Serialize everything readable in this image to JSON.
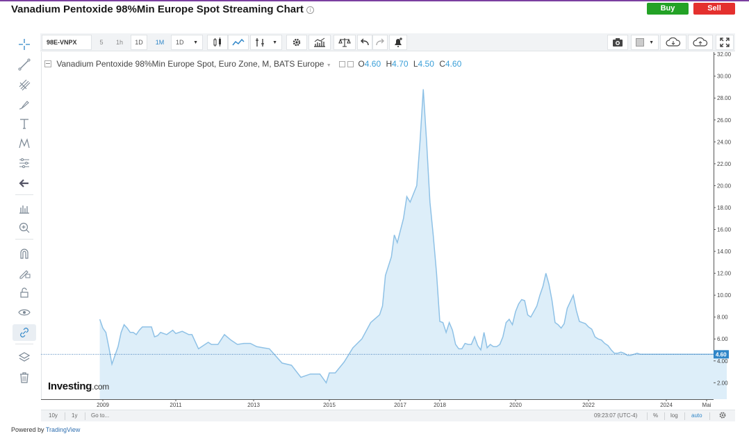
{
  "header": {
    "title": "Vanadium Pentoxide 98%Min Europe Spot Streaming Chart",
    "info_glyph": "i",
    "buy_label": "Buy",
    "sell_label": "Sell"
  },
  "toolbar": {
    "symbol": "98E-VNPX",
    "intervals": [
      "5",
      "1h",
      "1D",
      "1M"
    ],
    "active_interval": "1M",
    "interval_dropdown": "1D",
    "icons": [
      "bars-style-icon",
      "area-style-icon",
      "indicators-icon",
      "settings-icon",
      "studies-icon",
      "compare-icon",
      "undo-icon",
      "redo-icon",
      "alert-icon",
      "camera-icon",
      "layout-icon",
      "cloud-load-icon",
      "cloud-save-icon",
      "fullscreen-icon"
    ]
  },
  "left_tools": [
    "crosshair-icon",
    "trend-line-icon",
    "pitchfork-icon",
    "brush-icon",
    "text-icon",
    "pattern-icon",
    "measure-icon",
    "back-arrow-icon",
    "ruler-icon",
    "zoom-icon",
    "magnet-icon",
    "lock-drawing-icon",
    "unlock-icon",
    "eye-icon",
    "link-icon",
    "layers-icon",
    "trash-icon"
  ],
  "legend": {
    "name": "Vanadium Pentoxide 98%Min Europe Spot, Euro Zone, M, BATS Europe",
    "o_label": "O",
    "o_value": "4.60",
    "h_label": "H",
    "h_value": "4.70",
    "l_label": "L",
    "l_value": "4.50",
    "c_label": "C",
    "c_value": "4.60"
  },
  "watermark": {
    "brand": "Investing",
    "suffix": ".com"
  },
  "bottom_bar": {
    "range_10y": "10y",
    "range_1y": "1y",
    "goto": "Go to...",
    "clock": "09:23:07 (UTC-4)",
    "percent": "%",
    "log": "log",
    "auto": "auto"
  },
  "powered": {
    "prefix": "Powered by",
    "link": "TradingView"
  },
  "colors": {
    "line": "#8ec1e6",
    "fill": "#ddeef9",
    "last_price_badge": "#2f86c8",
    "buy": "#23a226",
    "sell": "#e4302e",
    "accent": "#2f86c8"
  },
  "chart_data": {
    "type": "area",
    "title": "Vanadium Pentoxide 98%Min Europe Spot, Euro Zone, M, BATS Europe",
    "y_ticks": [
      "2.00",
      "4.00",
      "6.00",
      "8.00",
      "10.00",
      "12.00",
      "14.00",
      "16.00",
      "18.00",
      "20.00",
      "22.00",
      "24.00",
      "26.00",
      "28.00",
      "30.00",
      "32.00"
    ],
    "x_ticks": [
      "2009",
      "2011",
      "2013",
      "2015",
      "2017",
      "2018",
      "2020",
      "2022",
      "2024",
      "Mai"
    ],
    "ylim": [
      0.5,
      32.2
    ],
    "last_price": 4.6,
    "last_price_label": "4.60",
    "grid": false,
    "x": [
      "2008-12",
      "2009-01",
      "2009-02",
      "2009-03",
      "2009-04",
      "2009-05",
      "2009-06",
      "2009-07",
      "2009-08",
      "2009-09",
      "2009-10",
      "2009-11",
      "2009-12",
      "2010-01",
      "2010-02",
      "2010-03",
      "2010-04",
      "2010-05",
      "2010-06",
      "2010-07",
      "2010-08",
      "2010-10",
      "2010-12",
      "2011-01",
      "2011-03",
      "2011-05",
      "2011-06",
      "2011-08",
      "2011-10",
      "2011-11",
      "2011-12",
      "2012-02",
      "2012-04",
      "2012-06",
      "2012-08",
      "2012-10",
      "2012-12",
      "2013-02",
      "2013-04",
      "2013-06",
      "2013-10",
      "2014-01",
      "2014-04",
      "2014-07",
      "2014-10",
      "2014-12",
      "2015-01",
      "2015-03",
      "2015-06",
      "2015-09",
      "2015-12",
      "2016-03",
      "2016-06",
      "2016-07",
      "2016-08",
      "2016-10",
      "2016-11",
      "2016-12",
      "2017-02",
      "2017-03",
      "2017-04",
      "2017-06",
      "2017-07",
      "2017-08",
      "2017-09",
      "2017-10",
      "2017-11",
      "2017-12",
      "2018-01",
      "2018-02",
      "2018-03",
      "2018-04",
      "2018-05",
      "2018-06",
      "2018-07",
      "2018-08",
      "2018-09",
      "2018-10",
      "2018-11",
      "2018-12",
      "2019-01",
      "2019-02",
      "2019-03",
      "2019-04",
      "2019-05",
      "2019-06",
      "2019-07",
      "2019-08",
      "2019-09",
      "2019-10",
      "2019-11",
      "2019-12",
      "2020-01",
      "2020-02",
      "2020-03",
      "2020-04",
      "2020-05",
      "2020-06",
      "2020-07",
      "2020-08",
      "2020-09",
      "2020-10",
      "2020-11",
      "2020-12",
      "2021-01",
      "2021-02",
      "2021-03",
      "2021-04",
      "2021-05",
      "2021-06",
      "2021-07",
      "2021-08",
      "2021-09",
      "2021-10",
      "2021-11",
      "2021-12",
      "2022-01",
      "2022-02",
      "2022-03",
      "2022-04",
      "2022-05",
      "2022-06",
      "2022-07",
      "2022-08",
      "2022-09",
      "2022-10",
      "2022-11",
      "2022-12",
      "2023-01",
      "2023-02",
      "2023-03",
      "2023-04",
      "2023-05",
      "2023-06",
      "2023-07",
      "2023-08",
      "2023-09",
      "2023-10",
      "2023-11",
      "2023-12",
      "2024-01",
      "2024-02",
      "2024-03",
      "2024-04",
      "2024-05",
      "2024-06",
      "2024-07"
    ],
    "series": [
      {
        "values": [
          7.8,
          7.0,
          6.6,
          5.2,
          3.7,
          4.5,
          5.3,
          6.6,
          7.3,
          7.0,
          6.6,
          6.6,
          6.4,
          6.8,
          7.1,
          7.1,
          7.1,
          7.1,
          6.2,
          6.3,
          6.6,
          6.4,
          6.8,
          6.5,
          6.7,
          6.4,
          6.4,
          5.1,
          5.5,
          5.7,
          5.5,
          5.5,
          6.4,
          5.9,
          5.5,
          5.6,
          5.6,
          5.3,
          5.2,
          5.1,
          3.8,
          3.6,
          2.5,
          2.8,
          2.8,
          2.0,
          2.9,
          2.9,
          3.9,
          5.2,
          6.0,
          7.5,
          8.2,
          9.0,
          11.8,
          13.5,
          15.5,
          14.8,
          17.0,
          19.0,
          18.5,
          20.0,
          24.0,
          28.8,
          24.0,
          18.5,
          15.5,
          12.0,
          7.6,
          7.5,
          6.6,
          7.5,
          6.8,
          5.5,
          5.1,
          5.1,
          5.6,
          5.5,
          5.5,
          6.2,
          5.4,
          5.0,
          6.6,
          5.2,
          5.5,
          5.3,
          5.3,
          5.5,
          6.2,
          7.5,
          7.8,
          7.3,
          8.5,
          9.2,
          9.6,
          9.5,
          8.2,
          8.0,
          8.5,
          9.0,
          10.0,
          10.8,
          12.0,
          11.0,
          9.5,
          7.5,
          7.3,
          7.0,
          7.4,
          8.8,
          9.4,
          10.0,
          8.6,
          7.6,
          7.5,
          7.4,
          7.1,
          6.9,
          6.2,
          6.0,
          5.9,
          5.6,
          5.4,
          5.0,
          4.7,
          4.7,
          4.8,
          4.7,
          4.5,
          4.5,
          4.6,
          4.7,
          4.6,
          4.6,
          4.6,
          4.6,
          4.6,
          4.6,
          4.6,
          4.6,
          4.6,
          4.6,
          4.6,
          4.6,
          4.6,
          4.6,
          4.6,
          4.6,
          4.6,
          4.6,
          4.6,
          4.6,
          4.6,
          4.6
        ]
      }
    ]
  }
}
